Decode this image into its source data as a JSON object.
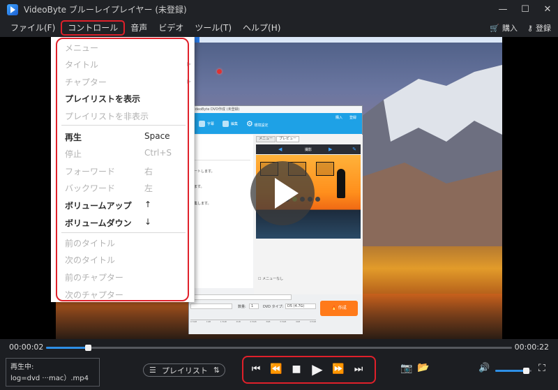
{
  "window": {
    "title": "VideoByte ブルーレイプレイヤー (未登録)",
    "min_glyph": "—",
    "max_glyph": "☐",
    "close_glyph": "✕"
  },
  "menubar": {
    "items": [
      "ファイル(F)",
      "コントロール",
      "音声",
      "ビデオ",
      "ツール(T)",
      "ヘルプ(H)"
    ],
    "active": "コントロール",
    "purchase": "購入",
    "register": "登録"
  },
  "control_menu": {
    "items": [
      {
        "label": "メニュー",
        "shortcut": "",
        "enabled": false,
        "submenu": false
      },
      {
        "label": "タイトル",
        "shortcut": "",
        "enabled": false,
        "submenu": true
      },
      {
        "label": "チャプター",
        "shortcut": "",
        "enabled": false,
        "submenu": true
      },
      {
        "label": "プレイリストを表示",
        "shortcut": "",
        "enabled": true,
        "submenu": false
      },
      {
        "label": "プレイリストを非表示",
        "shortcut": "",
        "enabled": false,
        "submenu": false
      },
      {
        "label": "再生",
        "shortcut": "Space",
        "enabled": true,
        "submenu": false
      },
      {
        "label": "停止",
        "shortcut": "Ctrl+S",
        "enabled": false,
        "submenu": false
      },
      {
        "label": "フォーワード",
        "shortcut": "右",
        "enabled": false,
        "submenu": false
      },
      {
        "label": "バックワード",
        "shortcut": "左",
        "enabled": false,
        "submenu": false
      },
      {
        "label": "ボリュームアップ",
        "shortcut": "↑",
        "enabled": true,
        "submenu": false
      },
      {
        "label": "ボリュームダウン",
        "shortcut": "↓",
        "enabled": true,
        "submenu": false
      },
      {
        "label": "前のタイトル",
        "shortcut": "",
        "enabled": false,
        "submenu": false
      },
      {
        "label": "次のタイトル",
        "shortcut": "",
        "enabled": false,
        "submenu": false
      },
      {
        "label": "前のチャプター",
        "shortcut": "",
        "enabled": false,
        "submenu": false
      },
      {
        "label": "次のチャプター",
        "shortcut": "",
        "enabled": false,
        "submenu": false
      }
    ]
  },
  "embedded_app": {
    "title": "VideoByte DVD作成 (未登録)",
    "toolbar": [
      "字幕",
      "編集",
      "環境設定"
    ],
    "purchase": "購入",
    "register": "登録",
    "tabs": [
      "メニュー",
      "プレビュー"
    ],
    "nav_label": "撮影",
    "left_lines": [
      "ポートします。",
      "します。",
      "編集します。"
    ],
    "no_menu": "メニューなし",
    "count_label": "数量:",
    "count_value": "1",
    "dvd_type_label": "DVD タイプ:",
    "dvd_type_value": "D5 (4.7G)",
    "make_button": "作成",
    "ruler": [
      "0.5GB",
      "1GB",
      "1.5GB",
      "2GB",
      "2.5GB",
      "3GB",
      "3.5GB",
      "4GB",
      "4.5GB"
    ]
  },
  "playback": {
    "current_time": "00:00:02",
    "total_time": "00:00:22",
    "progress": 0.09,
    "now_playing_label": "再生中:",
    "now_playing_file": "log=dvd ···mac）.mp4",
    "playlist_label": "プレイリスト",
    "volume": 0.85
  },
  "colors": {
    "accent": "#2e8fe6",
    "highlight": "#e0202a",
    "bg": "#1c1e22"
  }
}
